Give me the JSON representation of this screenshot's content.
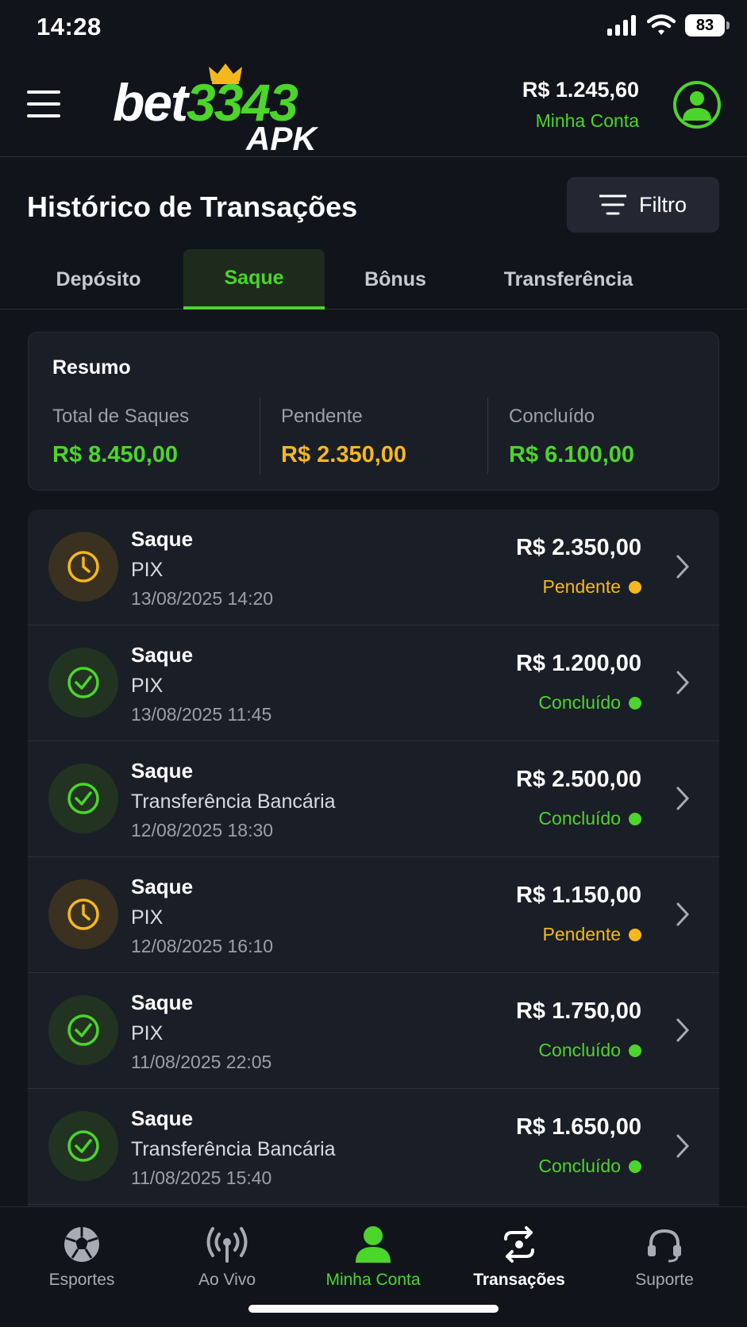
{
  "status_bar": {
    "time": "14:28",
    "battery": "83"
  },
  "header": {
    "logo_brand": "bet",
    "logo_number": "3343",
    "logo_sub": "APK",
    "balance": "R$ 1.245,60",
    "account_link": "Minha Conta"
  },
  "page": {
    "title": "Histórico de Transações",
    "filter_label": "Filtro"
  },
  "tabs": [
    {
      "label": "Depósito"
    },
    {
      "label": "Saque"
    },
    {
      "label": "Bônus"
    },
    {
      "label": "Transferência"
    }
  ],
  "summary": {
    "title": "Resumo",
    "total_label": "Total de Saques",
    "total_value": "R$ 8.450,00",
    "pending_label": "Pendente",
    "pending_value": "R$ 2.350,00",
    "completed_label": "Concluído",
    "completed_value": "R$ 6.100,00"
  },
  "transactions": [
    {
      "title": "Saque",
      "method": "PIX",
      "date": "13/08/2025 14:20",
      "amount": "R$ 2.350,00",
      "status": "Pendente"
    },
    {
      "title": "Saque",
      "method": "PIX",
      "date": "13/08/2025 11:45",
      "amount": "R$ 1.200,00",
      "status": "Concluído"
    },
    {
      "title": "Saque",
      "method": "Transferência Bancária",
      "date": "12/08/2025 18:30",
      "amount": "R$ 2.500,00",
      "status": "Concluído"
    },
    {
      "title": "Saque",
      "method": "PIX",
      "date": "12/08/2025 16:10",
      "amount": "R$ 1.150,00",
      "status": "Pendente"
    },
    {
      "title": "Saque",
      "method": "PIX",
      "date": "11/08/2025 22:05",
      "amount": "R$ 1.750,00",
      "status": "Concluído"
    },
    {
      "title": "Saque",
      "method": "Transferência Bancária",
      "date": "11/08/2025 15:40",
      "amount": "R$ 1.650,00",
      "status": "Concluído"
    }
  ],
  "bottom_nav": [
    {
      "label": "Esportes",
      "icon": "soccer-ball-icon"
    },
    {
      "label": "Ao Vivo",
      "icon": "live-broadcast-icon"
    },
    {
      "label": "Minha Conta",
      "icon": "user-icon"
    },
    {
      "label": "Transações",
      "icon": "transactions-icon"
    },
    {
      "label": "Suporte",
      "icon": "headset-icon"
    }
  ],
  "colors": {
    "background": "#11141b",
    "card": "#1a1e26",
    "accent_green": "#4cd52a",
    "pending_yellow": "#f5b81c",
    "muted": "#9aa0aa"
  }
}
